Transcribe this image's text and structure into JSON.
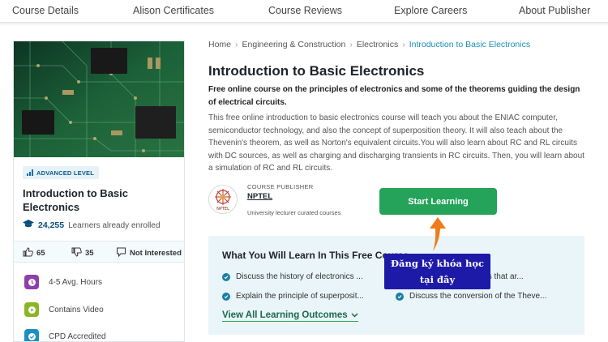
{
  "topnav": {
    "items": [
      "Course Details",
      "Alison Certificates",
      "Course Reviews",
      "Explore Careers",
      "About Publisher"
    ]
  },
  "card": {
    "level": "ADVANCED LEVEL",
    "title": "Introduction to Basic Electronics",
    "enrolled_count": "24,255",
    "enrolled_label": "Learners already enrolled",
    "likes": "65",
    "dislikes": "35",
    "not_interested": "Not Interested",
    "features": [
      {
        "label": "4-5 Avg. Hours",
        "icon": "clock-icon",
        "color": "#8e3fa8"
      },
      {
        "label": "Contains Video",
        "icon": "play-icon",
        "color": "#8bb526"
      },
      {
        "label": "CPD Accredited",
        "icon": "certificate-icon",
        "color": "#1b8fc4"
      }
    ]
  },
  "breadcrumb": [
    "Home",
    "Engineering & Construction",
    "Electronics",
    "Introduction to Basic Electronics"
  ],
  "course": {
    "title": "Introduction to Basic Electronics",
    "subtitle": "Free online course on the principles of electronics and some of the theorems guiding the design of electrical circuits.",
    "description": "This free online introduction to basic electronics course will teach you about the ENIAC computer, semiconductor technology, and also the concept of superposition theory. It will also teach about the Thevenin's theorem, as well as Norton's equivalent circuits.You will also learn about RC and RL circuits with DC sources, as well as charging and discharging transients in RC circuits. Then, you will learn about a simulation of RC and RL circuits."
  },
  "publisher": {
    "label": "COURSE PUBLISHER",
    "name": "NPTEL",
    "note": "University lecturer curated courses",
    "logo_text": "NPTEL"
  },
  "cta": {
    "label": "Start Learning"
  },
  "learn": {
    "title": "What You Will Learn In This Free Course",
    "outcomes": [
      "Discuss the history of electronics ...",
      "Recall useful theorems that ar...",
      "Explain the principle of superposit...",
      "Discuss the conversion of the Theve..."
    ],
    "view_all": "View All Learning Outcomes"
  },
  "annotation": {
    "line1": "Đăng ký khóa học",
    "line2": "tại đây"
  },
  "colors": {
    "accent_green": "#25a35a",
    "link_blue": "#1b8fb5",
    "annotation_bg": "#1e1aa8",
    "arrow": "#ef7b1a"
  }
}
